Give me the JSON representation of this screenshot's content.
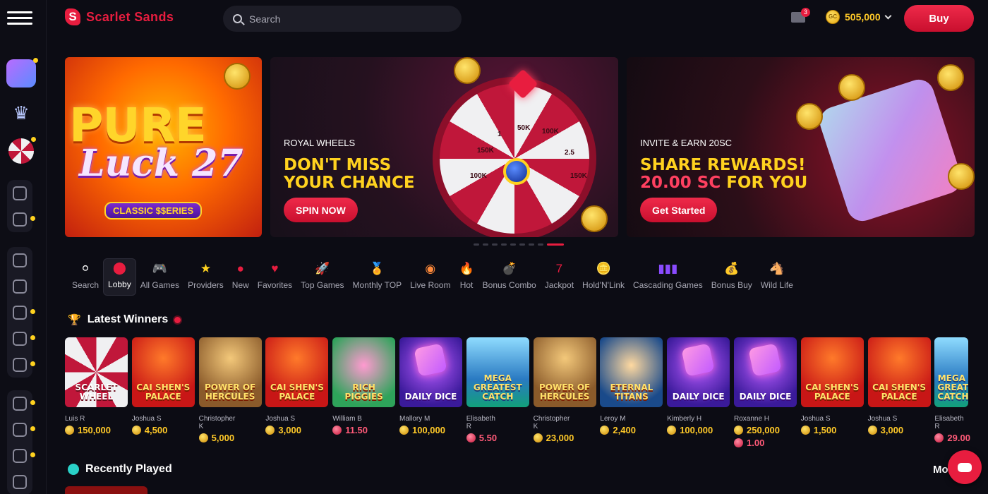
{
  "brand": {
    "name": "Scarlet Sands",
    "mark": "S"
  },
  "header": {
    "search_placeholder": "Search",
    "mail_badge": "3",
    "coin_label": "GC",
    "balance": "505,000",
    "buy_label": "Buy"
  },
  "banners": {
    "pure_luck": {
      "line1": "PURE",
      "line2": "Luck 27",
      "series": "CLASSIC $$ERIES"
    },
    "royal_wheels": {
      "category": "ROYAL WHEELS",
      "line1": "DON'T MISS",
      "line2": "YOUR CHANCE",
      "cta": "SPIN NOW",
      "wheel_labels": [
        "50K",
        "100K",
        "150K",
        "2.5",
        "1",
        "100K",
        "150K"
      ]
    },
    "invite": {
      "category": "INVITE & EARN 20SC",
      "line1": "SHARE REWARDS!",
      "line2_red": "20.00 SC",
      "line2_rest": " FOR YOU",
      "cta": "Get Started"
    }
  },
  "carousel": {
    "count": 9,
    "active_index": 8
  },
  "categories": [
    {
      "label": "Search",
      "icon": "search-icon",
      "glyph": "⚪",
      "color": "#ffffff"
    },
    {
      "label": "Lobby",
      "icon": "lobby-icon",
      "glyph": "⬤",
      "color": "#e81d3f"
    },
    {
      "label": "All Games",
      "icon": "gamepad-icon",
      "glyph": "🎮",
      "color": "#2ad1c8"
    },
    {
      "label": "Providers",
      "icon": "star-icon",
      "glyph": "★",
      "color": "#ffd21f"
    },
    {
      "label": "New",
      "icon": "new-icon",
      "glyph": "●",
      "color": "#e81d3f"
    },
    {
      "label": "Favorites",
      "icon": "heart-icon",
      "glyph": "♥",
      "color": "#e81d3f"
    },
    {
      "label": "Top Games",
      "icon": "rocket-icon",
      "glyph": "🚀",
      "color": "#e81d3f"
    },
    {
      "label": "Monthly TOP",
      "icon": "medal-icon",
      "glyph": "🏅",
      "color": "#ffb020"
    },
    {
      "label": "Live Room",
      "icon": "chips-icon",
      "glyph": "◉",
      "color": "#ff8a3a"
    },
    {
      "label": "Hot",
      "icon": "flame-icon",
      "glyph": "🔥",
      "color": "#ff6a20"
    },
    {
      "label": "Bonus Combo",
      "icon": "bomb-icon",
      "glyph": "💣",
      "color": "#2ad1c8"
    },
    {
      "label": "Jackpot",
      "icon": "seven-icon",
      "glyph": "7",
      "color": "#e81d3f"
    },
    {
      "label": "Hold'N'Link",
      "icon": "coins-icon",
      "glyph": "🪙",
      "color": "#ffd21f"
    },
    {
      "label": "Cascading Games",
      "icon": "bars-icon",
      "glyph": "▮▮▮",
      "color": "#8a4bff"
    },
    {
      "label": "Bonus Buy",
      "icon": "bag-icon",
      "glyph": "💰",
      "color": "#e81d3f"
    },
    {
      "label": "Wild Life",
      "icon": "horse-icon",
      "glyph": "🐴",
      "color": "#e81d3f"
    }
  ],
  "latest_winners": {
    "title": "Latest Winners",
    "items": [
      {
        "game": "SCARLET WHEEL",
        "style": "t-wheel",
        "user": "Luis R",
        "amounts": [
          {
            "value": "150,000",
            "type": "gc"
          }
        ]
      },
      {
        "game": "CAI SHEN'S PALACE",
        "style": "t-red",
        "user": "Joshua S",
        "amounts": [
          {
            "value": "4,500",
            "type": "gc"
          }
        ]
      },
      {
        "game": "POWER OF HERCULES",
        "style": "t-gold",
        "user": "Christopher K",
        "amounts": [
          {
            "value": "5,000",
            "type": "gc"
          }
        ]
      },
      {
        "game": "CAI SHEN'S PALACE",
        "style": "t-red",
        "user": "Joshua S",
        "amounts": [
          {
            "value": "3,000",
            "type": "gc"
          }
        ]
      },
      {
        "game": "RICH PIGGIES",
        "style": "t-pig",
        "user": "William B",
        "amounts": [
          {
            "value": "11.50",
            "type": "sc"
          }
        ]
      },
      {
        "game": "DAILY DICE",
        "style": "t-dice",
        "user": "Mallory M",
        "amounts": [
          {
            "value": "100,000",
            "type": "gc"
          }
        ]
      },
      {
        "game": "MEGA GREATEST CATCH",
        "style": "t-fish",
        "user": "Elisabeth R",
        "amounts": [
          {
            "value": "5.50",
            "type": "sc"
          }
        ]
      },
      {
        "game": "POWER OF HERCULES",
        "style": "t-gold",
        "user": "Christopher K",
        "amounts": [
          {
            "value": "23,000",
            "type": "gc"
          }
        ]
      },
      {
        "game": "ETERNAL TITANS",
        "style": "t-titan",
        "user": "Leroy M",
        "amounts": [
          {
            "value": "2,400",
            "type": "gc"
          }
        ]
      },
      {
        "game": "DAILY DICE",
        "style": "t-dice",
        "user": "Kimberly H",
        "amounts": [
          {
            "value": "100,000",
            "type": "gc"
          }
        ]
      },
      {
        "game": "DAILY DICE",
        "style": "t-dice",
        "user": "Roxanne H",
        "amounts": [
          {
            "value": "250,000",
            "type": "gc"
          },
          {
            "value": "1.00",
            "type": "sc"
          }
        ]
      },
      {
        "game": "CAI SHEN'S PALACE",
        "style": "t-red",
        "user": "Joshua S",
        "amounts": [
          {
            "value": "1,500",
            "type": "gc"
          }
        ]
      },
      {
        "game": "CAI SHEN'S PALACE",
        "style": "t-red",
        "user": "Joshua S",
        "amounts": [
          {
            "value": "3,000",
            "type": "gc"
          }
        ]
      },
      {
        "game": "MEGA GREATEST CATCH",
        "style": "t-fish",
        "user": "Elisabeth R",
        "amounts": [
          {
            "value": "29.00",
            "type": "sc"
          }
        ]
      }
    ]
  },
  "recently_played": {
    "title": "Recently Played",
    "more_label": "Mo"
  }
}
